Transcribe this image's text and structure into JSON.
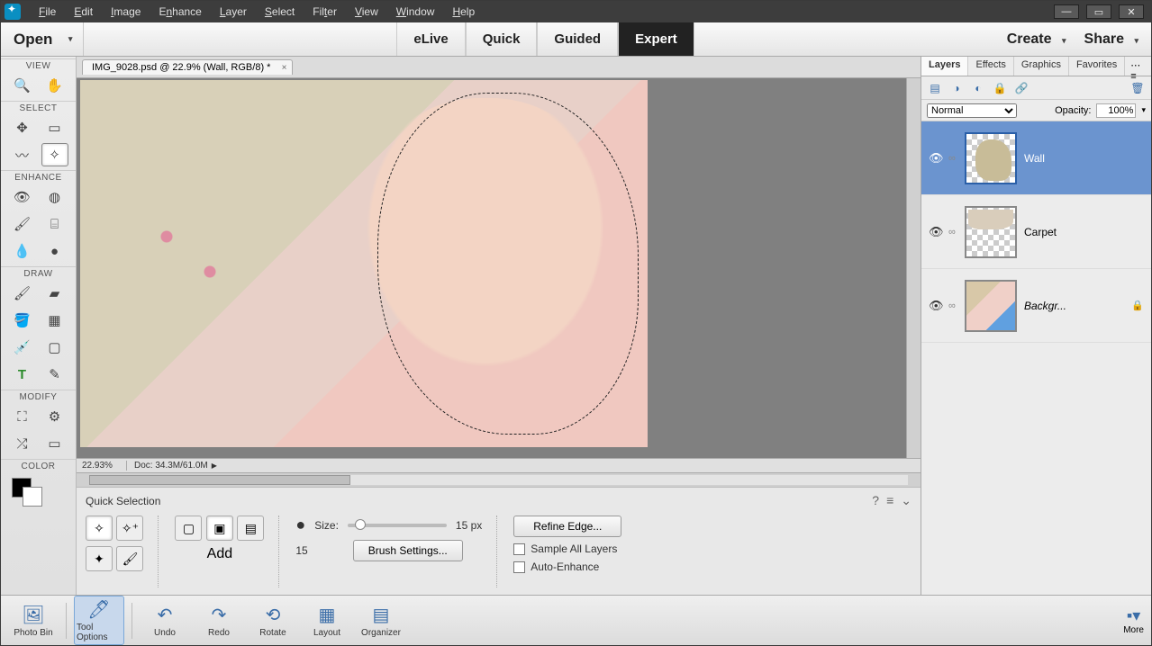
{
  "menubar": {
    "items": [
      "File",
      "Edit",
      "Image",
      "Enhance",
      "Layer",
      "Select",
      "Filter",
      "View",
      "Window",
      "Help"
    ]
  },
  "shelf": {
    "open": "Open",
    "modes": {
      "elive": "eLive",
      "quick": "Quick",
      "guided": "Guided",
      "expert": "Expert"
    },
    "create": "Create",
    "share": "Share"
  },
  "tool_sections": {
    "view": "VIEW",
    "select": "SELECT",
    "enhance": "ENHANCE",
    "draw": "DRAW",
    "modify": "MODIFY",
    "color": "COLOR"
  },
  "document_tab": {
    "title": "IMG_9028.psd @ 22.9% (Wall, RGB/8) *"
  },
  "status": {
    "zoom": "22.93%",
    "doc": "Doc: 34.3M/61.0M"
  },
  "options": {
    "tool_name": "Quick Selection",
    "mode_caption": "Add",
    "size_label": "Size:",
    "size_value": "15 px",
    "size_num": "15",
    "brush_settings": "Brush Settings...",
    "refine_edge": "Refine Edge...",
    "sample_all": "Sample All Layers",
    "auto_enhance": "Auto-Enhance"
  },
  "panels": {
    "tabs": {
      "layers": "Layers",
      "effects": "Effects",
      "graphics": "Graphics",
      "favorites": "Favorites"
    },
    "blend": {
      "mode": "Normal",
      "opacity_label": "Opacity:",
      "opacity_value": "100%"
    },
    "layers": [
      {
        "name": "Wall"
      },
      {
        "name": "Carpet"
      },
      {
        "name": "Backgr..."
      }
    ]
  },
  "bottombar": {
    "photo_bin": "Photo Bin",
    "tool_options": "Tool Options",
    "undo": "Undo",
    "redo": "Redo",
    "rotate": "Rotate",
    "layout": "Layout",
    "organizer": "Organizer",
    "more": "More"
  }
}
